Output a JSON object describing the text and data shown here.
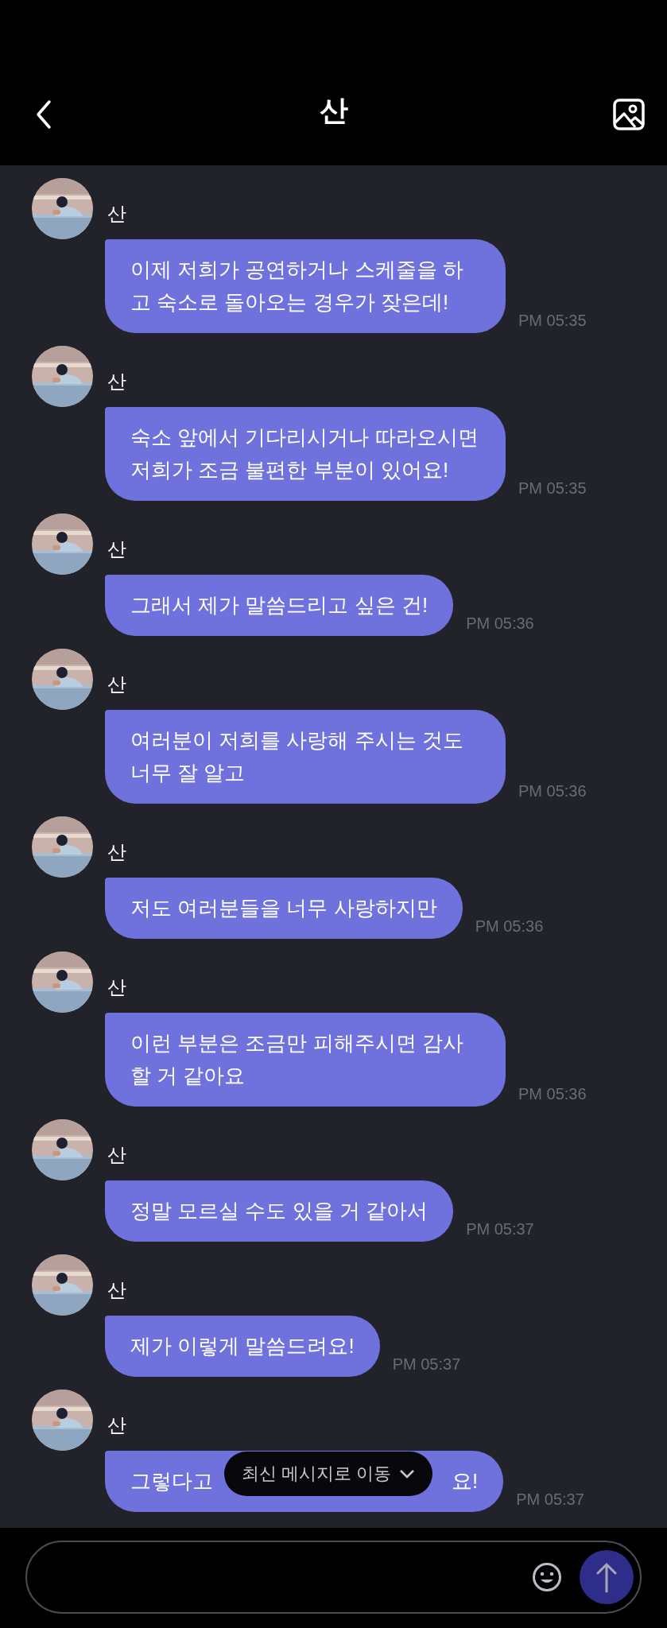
{
  "header": {
    "title": "산"
  },
  "messages": [
    {
      "sender": "산",
      "parts": [
        "이제 저희가 공연하거나 스케줄을 하고 숙소로 돌아오는 경우가 잦은데!"
      ],
      "time": "PM 05:35"
    },
    {
      "sender": "산",
      "parts": [
        "숙소 앞에서 기다리시거나 따라오시면 저희가 조금 불편한 부분이 있어요!"
      ],
      "time": "PM 05:35"
    },
    {
      "sender": "산",
      "parts": [
        "그래서 제가 말씀드리고 싶은 건!"
      ],
      "time": "PM 05:36"
    },
    {
      "sender": "산",
      "parts": [
        "여러분이 저희를 사랑해 주시는 것도 너무 잘 알고"
      ],
      "time": "PM 05:36"
    },
    {
      "sender": "산",
      "parts": [
        "저도 여러분들을 너무 사랑하지만"
      ],
      "time": "PM 05:36"
    },
    {
      "sender": "산",
      "parts": [
        "이런 부분은 조금만 피해주시면 감사할 거 같아요"
      ],
      "time": "PM 05:36"
    },
    {
      "sender": "산",
      "parts": [
        "정말 모르실 수도 있을 거 같아서"
      ],
      "time": "PM 05:37"
    },
    {
      "sender": "산",
      "parts": [
        "제가 이렇게 말씀드려요!"
      ],
      "time": "PM 05:37"
    },
    {
      "sender": "산",
      "parts": [
        "그렇다고",
        "요!"
      ],
      "time": "PM 05:37"
    }
  ],
  "jump_button": {
    "label": "최신 메시지로 이동"
  }
}
